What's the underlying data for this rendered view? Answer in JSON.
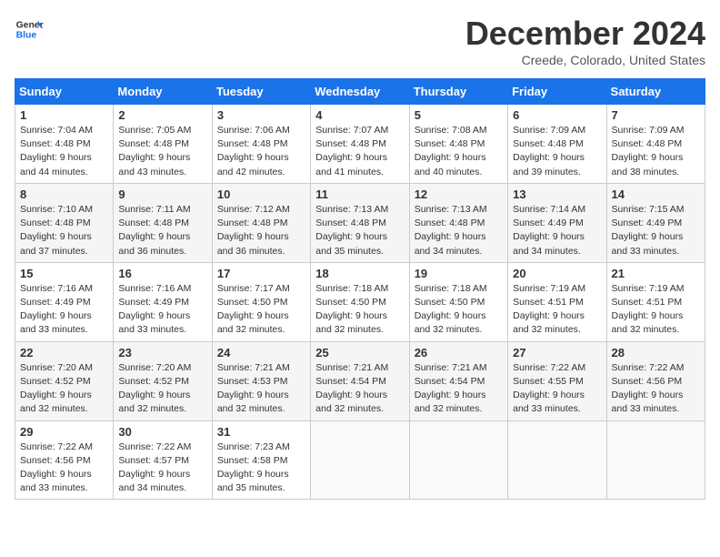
{
  "logo": {
    "line1": "General",
    "line2": "Blue"
  },
  "title": "December 2024",
  "location": "Creede, Colorado, United States",
  "header": {
    "accent_color": "#1a73e8"
  },
  "days_of_week": [
    "Sunday",
    "Monday",
    "Tuesday",
    "Wednesday",
    "Thursday",
    "Friday",
    "Saturday"
  ],
  "weeks": [
    [
      {
        "day": "1",
        "sunrise": "7:04 AM",
        "sunset": "4:48 PM",
        "daylight": "9 hours and 44 minutes."
      },
      {
        "day": "2",
        "sunrise": "7:05 AM",
        "sunset": "4:48 PM",
        "daylight": "9 hours and 43 minutes."
      },
      {
        "day": "3",
        "sunrise": "7:06 AM",
        "sunset": "4:48 PM",
        "daylight": "9 hours and 42 minutes."
      },
      {
        "day": "4",
        "sunrise": "7:07 AM",
        "sunset": "4:48 PM",
        "daylight": "9 hours and 41 minutes."
      },
      {
        "day": "5",
        "sunrise": "7:08 AM",
        "sunset": "4:48 PM",
        "daylight": "9 hours and 40 minutes."
      },
      {
        "day": "6",
        "sunrise": "7:09 AM",
        "sunset": "4:48 PM",
        "daylight": "9 hours and 39 minutes."
      },
      {
        "day": "7",
        "sunrise": "7:09 AM",
        "sunset": "4:48 PM",
        "daylight": "9 hours and 38 minutes."
      }
    ],
    [
      {
        "day": "8",
        "sunrise": "7:10 AM",
        "sunset": "4:48 PM",
        "daylight": "9 hours and 37 minutes."
      },
      {
        "day": "9",
        "sunrise": "7:11 AM",
        "sunset": "4:48 PM",
        "daylight": "9 hours and 36 minutes."
      },
      {
        "day": "10",
        "sunrise": "7:12 AM",
        "sunset": "4:48 PM",
        "daylight": "9 hours and 36 minutes."
      },
      {
        "day": "11",
        "sunrise": "7:13 AM",
        "sunset": "4:48 PM",
        "daylight": "9 hours and 35 minutes."
      },
      {
        "day": "12",
        "sunrise": "7:13 AM",
        "sunset": "4:48 PM",
        "daylight": "9 hours and 34 minutes."
      },
      {
        "day": "13",
        "sunrise": "7:14 AM",
        "sunset": "4:49 PM",
        "daylight": "9 hours and 34 minutes."
      },
      {
        "day": "14",
        "sunrise": "7:15 AM",
        "sunset": "4:49 PM",
        "daylight": "9 hours and 33 minutes."
      }
    ],
    [
      {
        "day": "15",
        "sunrise": "7:16 AM",
        "sunset": "4:49 PM",
        "daylight": "9 hours and 33 minutes."
      },
      {
        "day": "16",
        "sunrise": "7:16 AM",
        "sunset": "4:49 PM",
        "daylight": "9 hours and 33 minutes."
      },
      {
        "day": "17",
        "sunrise": "7:17 AM",
        "sunset": "4:50 PM",
        "daylight": "9 hours and 32 minutes."
      },
      {
        "day": "18",
        "sunrise": "7:18 AM",
        "sunset": "4:50 PM",
        "daylight": "9 hours and 32 minutes."
      },
      {
        "day": "19",
        "sunrise": "7:18 AM",
        "sunset": "4:50 PM",
        "daylight": "9 hours and 32 minutes."
      },
      {
        "day": "20",
        "sunrise": "7:19 AM",
        "sunset": "4:51 PM",
        "daylight": "9 hours and 32 minutes."
      },
      {
        "day": "21",
        "sunrise": "7:19 AM",
        "sunset": "4:51 PM",
        "daylight": "9 hours and 32 minutes."
      }
    ],
    [
      {
        "day": "22",
        "sunrise": "7:20 AM",
        "sunset": "4:52 PM",
        "daylight": "9 hours and 32 minutes."
      },
      {
        "day": "23",
        "sunrise": "7:20 AM",
        "sunset": "4:52 PM",
        "daylight": "9 hours and 32 minutes."
      },
      {
        "day": "24",
        "sunrise": "7:21 AM",
        "sunset": "4:53 PM",
        "daylight": "9 hours and 32 minutes."
      },
      {
        "day": "25",
        "sunrise": "7:21 AM",
        "sunset": "4:54 PM",
        "daylight": "9 hours and 32 minutes."
      },
      {
        "day": "26",
        "sunrise": "7:21 AM",
        "sunset": "4:54 PM",
        "daylight": "9 hours and 32 minutes."
      },
      {
        "day": "27",
        "sunrise": "7:22 AM",
        "sunset": "4:55 PM",
        "daylight": "9 hours and 33 minutes."
      },
      {
        "day": "28",
        "sunrise": "7:22 AM",
        "sunset": "4:56 PM",
        "daylight": "9 hours and 33 minutes."
      }
    ],
    [
      {
        "day": "29",
        "sunrise": "7:22 AM",
        "sunset": "4:56 PM",
        "daylight": "9 hours and 33 minutes."
      },
      {
        "day": "30",
        "sunrise": "7:22 AM",
        "sunset": "4:57 PM",
        "daylight": "9 hours and 34 minutes."
      },
      {
        "day": "31",
        "sunrise": "7:23 AM",
        "sunset": "4:58 PM",
        "daylight": "9 hours and 35 minutes."
      },
      null,
      null,
      null,
      null
    ]
  ]
}
